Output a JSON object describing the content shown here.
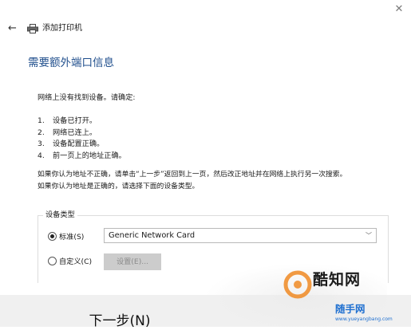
{
  "window": {
    "close_icon": "close-icon",
    "back_icon": "back-arrow-icon",
    "title_icon": "printer-icon",
    "title": "添加打印机"
  },
  "page": {
    "heading": "需要额外端口信息",
    "intro": "网络上没有找到设备。请确定:",
    "steps": [
      {
        "num": "1.",
        "text": "设备已打开。"
      },
      {
        "num": "2.",
        "text": "网络已连上。"
      },
      {
        "num": "3.",
        "text": "设备配置正确。"
      },
      {
        "num": "4.",
        "text": "前一页上的地址正确。"
      }
    ],
    "note_line1": "如果你认为地址不正确，请单击“上一步”返回到上一页，然后改正地址并在网络上执行另一次搜索。",
    "note_line2": "如果你认为地址是正确的，请选择下面的设备类型。"
  },
  "device_type": {
    "group_label": "设备类型",
    "standard_label": "标准(S)",
    "standard_selected": true,
    "standard_value": "Generic Network Card",
    "custom_label": "自定义(C)",
    "custom_selected": false,
    "settings_button": "设置(E)..."
  },
  "footer": {
    "next_button": "下一步(N)"
  },
  "watermark": {
    "site_name": "酷知网",
    "site_name_2": "随手网",
    "url": "www.yueyangbang.com",
    "accent_color": "#1e6fd0",
    "logo_color": "#f08a24"
  },
  "colors": {
    "heading": "#1f4e8c",
    "footer_bg": "#f0f0f0",
    "disabled_button": "#cccccc"
  }
}
